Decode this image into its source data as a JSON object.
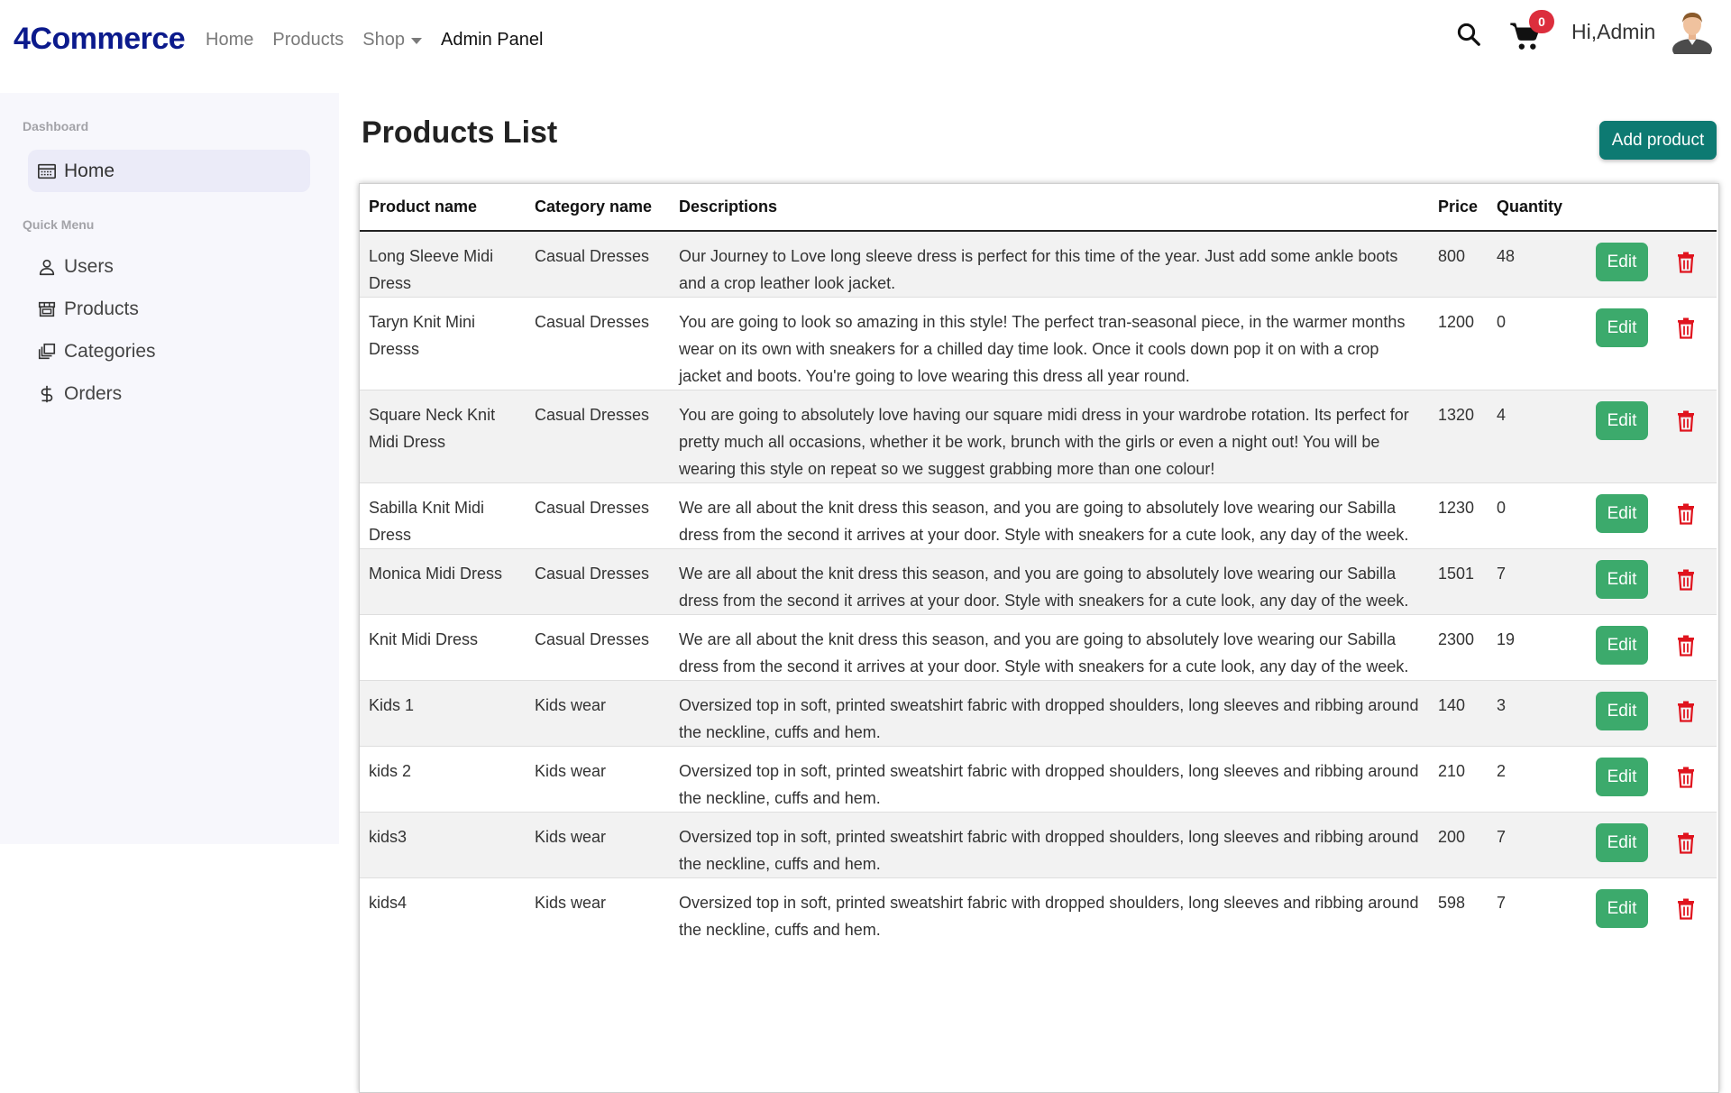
{
  "navbar": {
    "brand": "4Commerce",
    "links": [
      {
        "label": "Home"
      },
      {
        "label": "Products"
      },
      {
        "label": "Shop"
      },
      {
        "label": "Admin Panel"
      }
    ],
    "cart_count": "0",
    "greeting": "Hi,Admin",
    "icons": [
      "search-icon",
      "cart-icon",
      "avatar"
    ]
  },
  "sidebar": {
    "dashboard_heading": "Dashboard",
    "home_label": "Home",
    "quick_menu_heading": "Quick Menu",
    "items": [
      {
        "label": "Users",
        "icon": "user-icon"
      },
      {
        "label": "Products",
        "icon": "storefront-icon"
      },
      {
        "label": "Categories",
        "icon": "categories-icon"
      },
      {
        "label": "Orders",
        "icon": "dollar-icon"
      }
    ]
  },
  "main": {
    "title": "Products List",
    "add_button": "Add product"
  },
  "table": {
    "headers": {
      "name": "Product name",
      "category": "Category name",
      "description": "Descriptions",
      "price": "Price",
      "quantity": "Quantity"
    },
    "edit_label": "Edit",
    "rows": [
      {
        "name": "Long Sleeve Midi Dress",
        "category": "Casual Dresses",
        "description": "Our Journey to Love long sleeve dress is perfect for this time of the year. Just add some ankle boots and a crop leather look jacket.",
        "price": "800",
        "quantity": "48"
      },
      {
        "name": "Taryn Knit Mini Dresss",
        "category": "Casual Dresses",
        "description": "You are going to look so amazing in this style! The perfect tran-seasonal piece, in the warmer months wear on its own with sneakers for a chilled day time look. Once it cools down pop it on with a crop jacket and boots. You're going to love wearing this dress all year round.",
        "price": "1200",
        "quantity": "0"
      },
      {
        "name": "Square Neck Knit Midi Dress",
        "category": "Casual Dresses",
        "description": "You are going to absolutely love having our square midi dress in your wardrobe rotation. Its perfect for pretty much all occasions, whether it be work, brunch with the girls or even a night out! You will be wearing this style on repeat so we suggest grabbing more than one colour!",
        "price": "1320",
        "quantity": "4"
      },
      {
        "name": "Sabilla Knit Midi Dress",
        "category": "Casual Dresses",
        "description": "We are all about the knit dress this season, and you are going to absolutely love wearing our Sabilla dress from the second it arrives at your door. Style with sneakers for a cute look, any day of the week.",
        "price": "1230",
        "quantity": "0"
      },
      {
        "name": "Monica Midi Dress",
        "category": "Casual Dresses",
        "description": "We are all about the knit dress this season, and you are going to absolutely love wearing our Sabilla dress from the second it arrives at your door. Style with sneakers for a cute look, any day of the week.",
        "price": "1501",
        "quantity": "7"
      },
      {
        "name": "Knit Midi Dress",
        "category": "Casual Dresses",
        "description": "We are all about the knit dress this season, and you are going to absolutely love wearing our Sabilla dress from the second it arrives at your door. Style with sneakers for a cute look, any day of the week.",
        "price": "2300",
        "quantity": "19"
      },
      {
        "name": "Kids 1",
        "category": "Kids wear",
        "description": "Oversized top in soft, printed sweatshirt fabric with dropped shoulders, long sleeves and ribbing around the neckline, cuffs and hem.",
        "price": "140",
        "quantity": "3"
      },
      {
        "name": "kids 2",
        "category": "Kids wear",
        "description": "Oversized top in soft, printed sweatshirt fabric with dropped shoulders, long sleeves and ribbing around the neckline, cuffs and hem.",
        "price": "210",
        "quantity": "2"
      },
      {
        "name": "kids3",
        "category": "Kids wear",
        "description": "Oversized top in soft, printed sweatshirt fabric with dropped shoulders, long sleeves and ribbing around the neckline, cuffs and hem.",
        "price": "200",
        "quantity": "7"
      },
      {
        "name": "kids4",
        "category": "Kids wear",
        "description": "Oversized top in soft, printed sweatshirt fabric with dropped shoulders, long sleeves and ribbing around the neckline, cuffs and hem.",
        "price": "598",
        "quantity": "7"
      }
    ]
  },
  "colors": {
    "brand": "#0b1a8c",
    "add_button": "#0d7a72",
    "edit_button": "#3caa6c",
    "delete_icon": "#e0141e",
    "cart_badge": "#dc2e3d"
  }
}
